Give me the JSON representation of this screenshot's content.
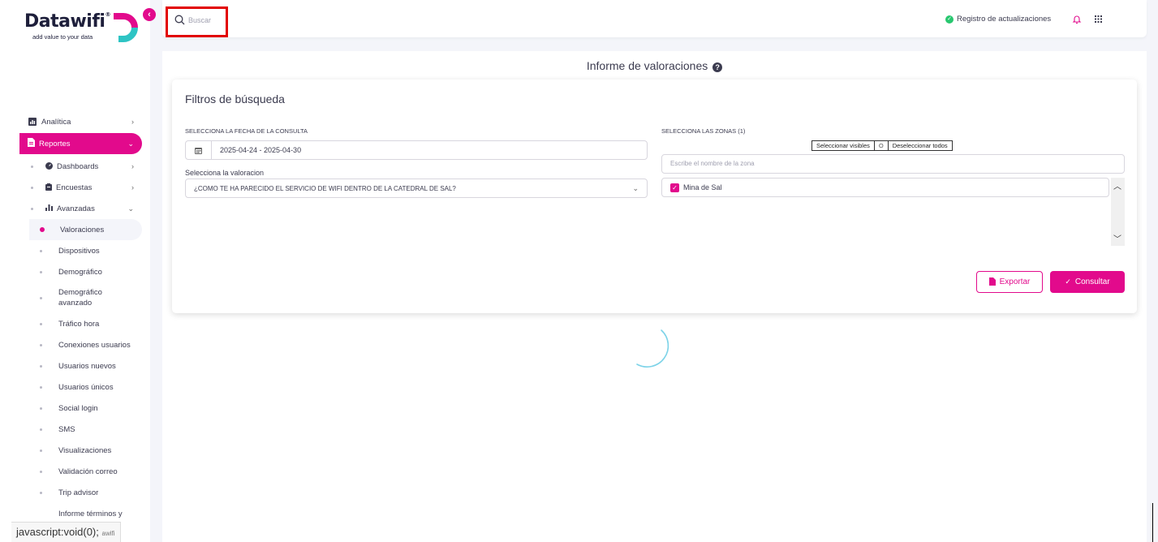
{
  "logo": {
    "name": "Datawifi",
    "reg": "®",
    "tagline": "add value to your data"
  },
  "sidebar": {
    "collapse_icon": "chevron-left-icon",
    "items": [
      {
        "label": "Analítica",
        "icon": "chart-icon"
      },
      {
        "label": "Reportes",
        "icon": "document-icon"
      }
    ],
    "sub_items": [
      {
        "label": "Dashboards",
        "icon": "gauge-icon"
      },
      {
        "label": "Encuestas",
        "icon": "clipboard-icon"
      },
      {
        "label": "Avanzadas",
        "icon": "bar-chart-icon"
      }
    ],
    "leaves": [
      {
        "label": "Valoraciones"
      },
      {
        "label": "Dispositivos"
      },
      {
        "label": "Demográfico"
      },
      {
        "label": "Demográfico avanzado"
      },
      {
        "label": "Tráfico hora"
      },
      {
        "label": "Conexiones usuarios"
      },
      {
        "label": "Usuarios nuevos"
      },
      {
        "label": "Usuarios únicos"
      },
      {
        "label": "Social login"
      },
      {
        "label": "SMS"
      },
      {
        "label": "Visualizaciones"
      },
      {
        "label": "Validación correo"
      },
      {
        "label": "Trip advisor"
      },
      {
        "label": "Informe términos y"
      }
    ]
  },
  "status_bar": {
    "text": "javascript:void(0);",
    "tail": "awifi"
  },
  "topbar": {
    "search_placeholder": "Buscar",
    "changelog_label": "Registro de actualizaciones"
  },
  "page": {
    "title": "Informe de valoraciones"
  },
  "filters": {
    "title": "Filtros de búsqueda",
    "date_label": "SELECCIONA LA FECHA DE LA CONSULTA",
    "date_value": "2025-04-24 - 2025-04-30",
    "rating_label": "Selecciona la valoracion",
    "rating_value": "¿COMO TE HA PARECIDO EL SERVICIO DE WIFI DENTRO DE LA CATEDRAL DE SAL?",
    "zones_label": "SELECCIONA LAS ZONAS (1)",
    "select_visible": "Seleccionar visibles",
    "or": "O",
    "deselect_all": "Deseleccionar todos",
    "zone_placeholder": "Escribe el nombre de la zona",
    "zones": [
      {
        "name": "Mina de Sal",
        "checked": true
      }
    ],
    "export_label": "Exportar",
    "consult_label": "Consultar"
  },
  "colors": {
    "accent": "#e20a8c",
    "success": "#28c76f",
    "spinner": "#7dd3e8"
  }
}
